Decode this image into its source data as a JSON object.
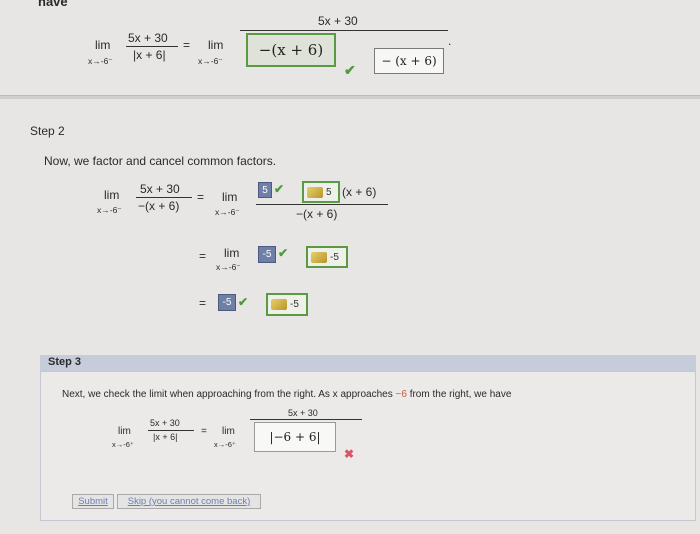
{
  "top": {
    "header_fragment": "have",
    "lim": "lim",
    "sub": "x→-6⁻",
    "num": "5x + 30",
    "den": "|x + 6|",
    "eq": "=",
    "rhs_num": "5x + 30",
    "rhs_box": "−(x + 6)",
    "rhs_answer": "− (x + 6)",
    "dot": "."
  },
  "step2": {
    "title": "Step 2",
    "instruction": "Now, we factor and cancel common factors.",
    "lim": "lim",
    "sub": "x→-6⁻",
    "num": "5x + 30",
    "den": "−(x + 6)",
    "eq": "=",
    "box1_val": "5",
    "box1_answer": "5",
    "factor_text": "(x + 6)",
    "rhs_den": "−(x + 6)",
    "line2_box": "-5",
    "line2_answer": "-5",
    "line3_box": "-5",
    "line3_answer": "-5"
  },
  "step3": {
    "title": "Step 3",
    "instruction": "Next, we check the limit when approaching from the right. As x approaches",
    "instruction_value": "−6",
    "instruction_end": "from the right, we have",
    "lim": "lim",
    "sub": "x→-6⁺",
    "num": "5x + 30",
    "den": "|x + 6|",
    "eq": "=",
    "rhs_num": "5x + 30",
    "input_value": "|−6 + 6|",
    "submit_label": "Submit",
    "skip_label": "Skip (you cannot come back)"
  },
  "colors": {
    "correct": "#4f9a3a",
    "incorrect": "#d5566a",
    "tag": "#6f7fa6"
  },
  "icons": {
    "check": "✔",
    "cross": "✖"
  }
}
